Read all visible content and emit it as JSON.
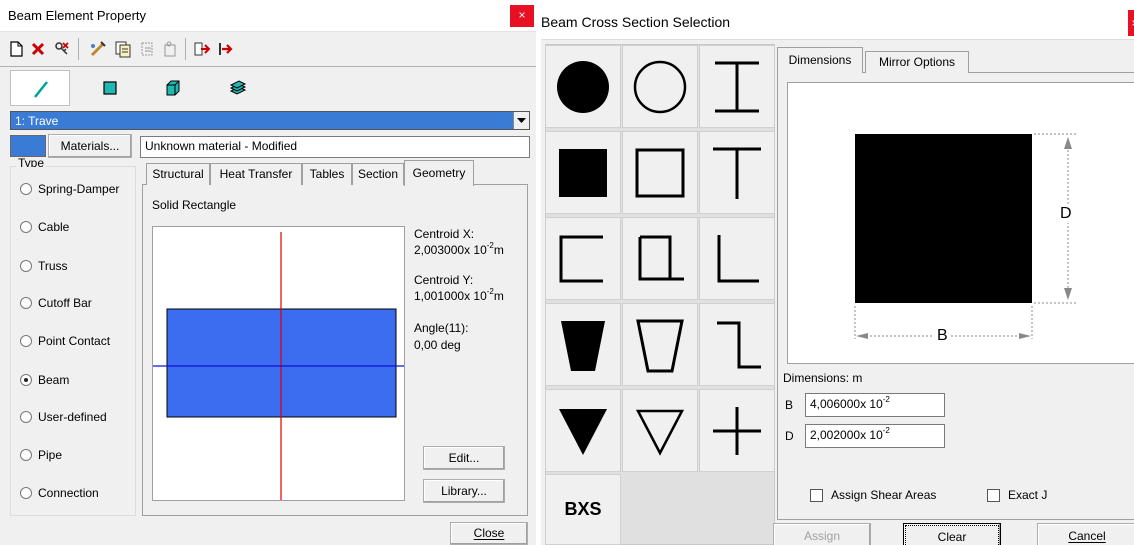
{
  "left": {
    "title": "Beam Element Property",
    "close_glyph": "×",
    "toolbar_icons": [
      "new-icon",
      "delete-icon",
      "key-icon",
      "edit-icon",
      "copy-icon",
      "paste-icon",
      "paste-alt-icon",
      "import-icon",
      "export-icon"
    ],
    "element_tabs": [
      "line-icon",
      "square-icon",
      "cube-icon",
      "layers-icon"
    ],
    "part_select": "1: Trave",
    "materials_label": "Materials...",
    "material_name": "Unknown material - Modified",
    "type_legend": "Type",
    "types": [
      {
        "label": "Spring-Damper",
        "selected": false
      },
      {
        "label": "Cable",
        "selected": false
      },
      {
        "label": "Truss",
        "selected": false
      },
      {
        "label": "Cutoff Bar",
        "selected": false
      },
      {
        "label": "Point Contact",
        "selected": false
      },
      {
        "label": "Beam",
        "selected": true
      },
      {
        "label": "User-defined",
        "selected": false
      },
      {
        "label": "Pipe",
        "selected": false
      },
      {
        "label": "Connection",
        "selected": false
      }
    ],
    "tabs": [
      "Structural",
      "Heat Transfer",
      "Tables",
      "Section",
      "Geometry"
    ],
    "active_tab": "Geometry",
    "section_name": "Solid Rectangle",
    "centroid_x_label": "Centroid X:",
    "centroid_x_value": "2,003000",
    "centroid_y_label": "Centroid Y:",
    "centroid_y_value": "1,001000",
    "exp_times": "x 10",
    "exp": "-2",
    "unit": "m",
    "angle_label": "Angle(11):",
    "angle_value": "0,00 deg",
    "edit_label": "Edit...",
    "library_label": "Library...",
    "close_label": "Close"
  },
  "right": {
    "title": "Beam Cross Section Selection",
    "close_glyph": "×",
    "shapes": [
      "solid-circle-icon",
      "hollow-circle-icon",
      "i-beam-icon",
      "solid-square-icon",
      "hollow-square-icon",
      "t-beam-icon",
      "channel-icon",
      "hat-channel-icon",
      "angle-icon",
      "solid-trapezoid-icon",
      "hollow-trapezoid-icon",
      "z-section-icon",
      "solid-triangle-icon",
      "hollow-triangle-icon",
      "cross-icon"
    ],
    "bxs_label": "BXS",
    "tabs": [
      "Dimensions",
      "Mirror Options"
    ],
    "active_tab": "Dimensions",
    "dim_d": "D",
    "dim_b": "B",
    "dimensions_label": "Dimensions: m",
    "b_label": "B",
    "b_value": "4,006000",
    "d_label": "D",
    "d_value": "2,002000",
    "exp_times": "x 10",
    "exp": "-2",
    "assign_shear_label": "Assign Shear Areas",
    "exact_j_label": "Exact J",
    "assign_label": "Assign",
    "clear_label": "Clear",
    "cancel_label": "Cancel"
  },
  "colors": {
    "select_blue": "#3a7bd5",
    "section_fill": "#3c6cf0",
    "centroid_red": "#e00000",
    "close_red": "#e81123"
  }
}
